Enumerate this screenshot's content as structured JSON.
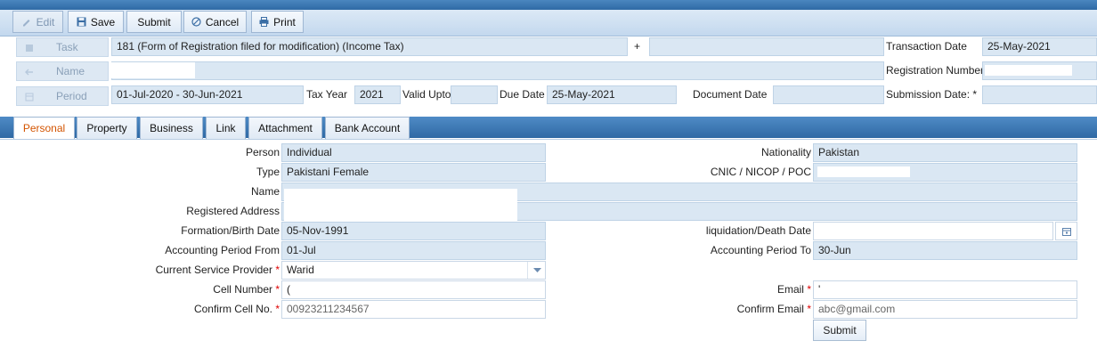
{
  "toolbar": {
    "edit": "Edit",
    "save": "Save",
    "submit": "Submit",
    "cancel": "Cancel",
    "print": "Print"
  },
  "header": {
    "task_label": "Task",
    "task_value": "181 (Form of Registration filed for modification) (Income Tax)",
    "plus": "+",
    "name_label": "Name",
    "period_label": "Period",
    "period_value": "01-Jul-2020 -  30-Jun-2021",
    "tax_year_label": "Tax Year",
    "tax_year_value": "2021",
    "valid_upto_label": "Valid Upto",
    "due_date_label": "Due Date",
    "due_date_value": "25-May-2021",
    "document_date_label": "Document Date",
    "transaction_date_label": "Transaction Date",
    "transaction_date_value": "25-May-2021",
    "registration_number_label": "Registration Number",
    "submission_date_label": "Submission Date: *"
  },
  "tabs": [
    "Personal",
    "Property",
    "Business",
    "Link",
    "Attachment",
    "Bank Account"
  ],
  "personal": {
    "person_label": "Person",
    "person_value": "Individual",
    "type_label": "Type",
    "type_value": "Pakistani Female",
    "name_label": "Name",
    "registered_address_label": "Registered Address",
    "formation_birth_label": "Formation/Birth Date",
    "formation_birth_value": "05-Nov-1991",
    "acc_from_label": "Accounting Period From",
    "acc_from_value": "01-Jul",
    "service_provider_label": "Current Service Provider",
    "service_provider_value": "Warid",
    "cell_label": "Cell Number",
    "cell_value": "(",
    "confirm_cell_label": "Confirm Cell No.",
    "confirm_cell_value": "00923211234567",
    "nationality_label": "Nationality",
    "nationality_value": "Pakistan",
    "cnic_label": "CNIC / NICOP / POC",
    "liquidation_label": "liquidation/Death Date",
    "acc_to_label": "Accounting Period To",
    "acc_to_value": "30-Jun",
    "email_label": "Email",
    "email_value": "'",
    "confirm_email_label": "Confirm Email",
    "confirm_email_value": "abc@gmail.com",
    "submit": "Submit",
    "required_mark": "*"
  }
}
